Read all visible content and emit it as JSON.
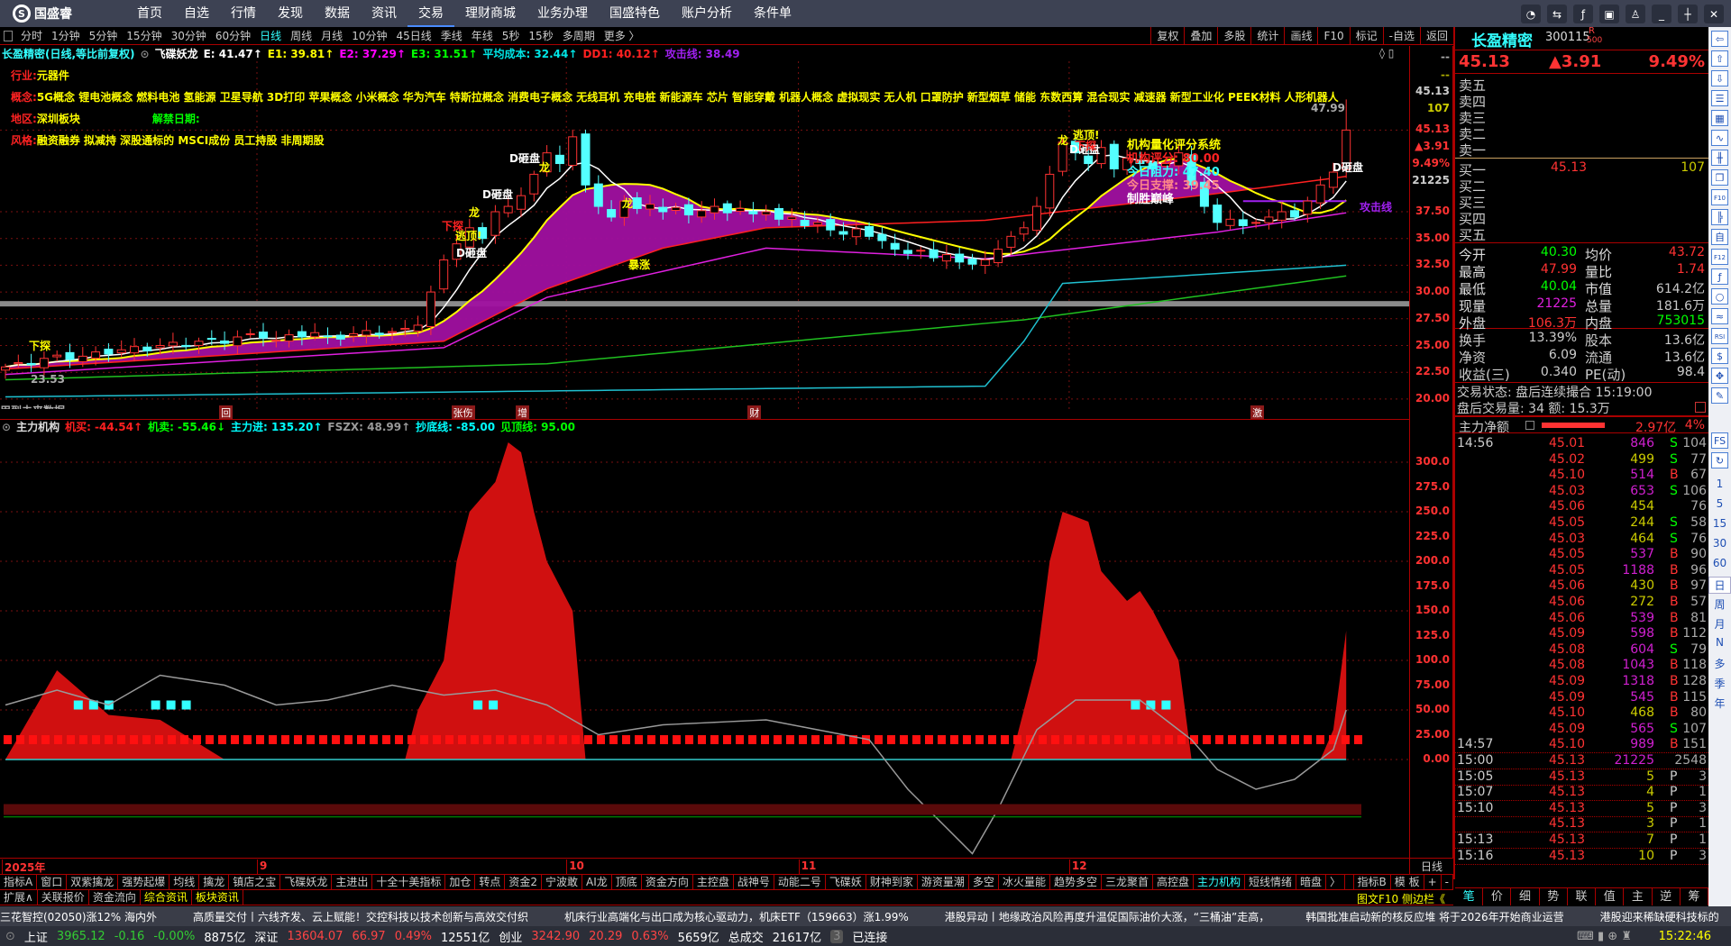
{
  "app": {
    "logo": "国盛睿",
    "menu": [
      "首页",
      "自选",
      "行情",
      "发现",
      "数据",
      "资讯",
      "交易",
      "理财商城",
      "业务办理",
      "国盛特色",
      "账户分析",
      "条件单"
    ],
    "active_menu": "交易",
    "window_controls": [
      "message-icon",
      "settings-icon",
      "formula-icon",
      "monitor-icon",
      "skin-icon",
      "minimize-icon",
      "restore-icon",
      "close-icon"
    ]
  },
  "periods": [
    "分时",
    "1分钟",
    "5分钟",
    "15分钟",
    "30分钟",
    "60分钟",
    "日线",
    "周线",
    "月线",
    "10分钟",
    "45日线",
    "季线",
    "年线",
    "5秒",
    "15秒",
    "多周期",
    "更多 〉"
  ],
  "active_period": "日线",
  "chart_tools": [
    "复权",
    "叠加",
    "多股",
    "统计",
    "画线",
    "F10",
    "标记",
    "-自选",
    "返回"
  ],
  "chart_header": {
    "title": "长盈精密(日线,等比前复权)",
    "indicator": "飞碟妖龙",
    "items": [
      {
        "label": "E: 41.47↑",
        "color": "#ffffff"
      },
      {
        "label": "E1: 39.81↑",
        "color": "#ffff00"
      },
      {
        "label": "E2: 37.29↑",
        "color": "#ff00ff"
      },
      {
        "label": "E3: 31.51↑",
        "color": "#00ff00"
      },
      {
        "label": "平均成本: 32.44↑",
        "color": "#00e5e5"
      },
      {
        "label": "DD1: 40.12↑",
        "color": "#ff2020"
      },
      {
        "label": "攻击线: 38.49",
        "color": "#a020f0"
      }
    ]
  },
  "info": {
    "industry_label": "行业:",
    "industry": "元器件",
    "concept_label": "概念:",
    "concepts": "5G概念 锂电池概念 燃料电池 氢能源 卫星导航 3D打印 苹果概念 小米概念 华为汽车 特斯拉概念 消费电子概念 无线耳机 充电桩 新能源车 芯片 智能穿戴 机器人概念 虚拟现实 无人机 口罩防护 新型烟草 储能 东数西算 混合现实 减速器 新型工业化 PEEK材料 人形机器人",
    "region_label": "地区:",
    "region": "深圳板块",
    "unlock_label": "解禁日期:",
    "style_label": "风格:",
    "styles": "融资融券 拟减持 深股通标的 MSCI成份 员工持股 非周期股"
  },
  "annotations": {
    "d1": "D砸盘",
    "d2": "D砸盘",
    "d3": "D砸盘",
    "d4": "D砸盘",
    "d5": "D砸盘",
    "dragon1": "龙",
    "dragon2": "龙",
    "dragon3": "龙",
    "dragon4": "龙",
    "escape1": "逃顶!",
    "escape2": "逃顶!",
    "probe1": "下探",
    "probe2": "下探",
    "surge": "暴涨",
    "attack": "攻击线",
    "sys_title": "机构量化评分系统",
    "score": "机构评分: 80.00",
    "resist": "今日阻力: 47.40",
    "support": "今日支撑: 39.45",
    "peak": "制胜巅峰",
    "high_mark": "47.99",
    "low_mark": "23.53",
    "future": "用到未来数据",
    "start": "下探"
  },
  "price_axis": {
    "top": [
      "--",
      "--",
      "45.13",
      "107",
      "45.13",
      "▲3.91",
      "9.49%",
      "21225"
    ],
    "ticks": [
      "37.50",
      "35.00",
      "32.50",
      "30.00",
      "27.50",
      "25.00",
      "22.50",
      "20.00"
    ]
  },
  "markers": [
    {
      "label": "回",
      "i": 17
    },
    {
      "label": "张伤",
      "i": 35
    },
    {
      "label": "增",
      "i": 40
    },
    {
      "label": "财",
      "i": 58
    },
    {
      "label": "激",
      "i": 97
    }
  ],
  "indicator_header": {
    "name": "主力机构",
    "items": [
      {
        "label": "机买: -44.54↑",
        "color": "#ff2020"
      },
      {
        "label": "机卖: -55.46↓",
        "color": "#00ff00"
      },
      {
        "label": "主力进: 135.20↑",
        "color": "#00ffff"
      },
      {
        "label": "FSZX: 48.99↑",
        "color": "#9a9a9a"
      },
      {
        "label": "抄底线: -85.00",
        "color": "#00ffff"
      },
      {
        "label": "见顶线: 95.00",
        "color": "#00ff00"
      }
    ]
  },
  "indicator_axis": [
    "300.0",
    "275.0",
    "250.0",
    "225.0",
    "200.0",
    "175.0",
    "150.0",
    "125.0",
    "100.0",
    "75.00",
    "50.00",
    "25.00",
    "0.00"
  ],
  "dates": [
    {
      "label": "2025年",
      "i": 0
    },
    {
      "label": "9",
      "i": 20
    },
    {
      "label": "10",
      "i": 44
    },
    {
      "label": "11",
      "i": 62
    },
    {
      "label": "12",
      "i": 83
    }
  ],
  "period_label": "日线",
  "tabs_row1": [
    "指标A",
    "窗口",
    "双紫擒龙",
    "强势起爆",
    "均线",
    "擒龙",
    "镇店之宝",
    "飞碟妖龙",
    "主进出",
    "十全十美指标",
    "加仓",
    "转点",
    "资金2",
    "宁波敢",
    "AI龙",
    "顶底",
    "资金方向",
    "主控盘",
    "战神号",
    "动能二号",
    "飞碟妖",
    "财神到家",
    "游资量潮",
    "多空",
    "冰火量能",
    "趋势多空",
    "三龙聚首",
    "高控盘",
    "主力机构",
    "短线情绪",
    "暗盘",
    "〉"
  ],
  "tabs_row1_right": [
    "指标B",
    "模 板",
    "+",
    "-"
  ],
  "active_tab": "主力机构",
  "tabs_row2": [
    "扩展∧",
    "关联报价",
    "资金流向",
    "综合资讯",
    "板块资讯"
  ],
  "tabs_row2_right": "图文F10 侧边栏《",
  "ticker": [
    "三花智控(02050)涨12% 海内外",
    "高质量交付丨六线齐发、云上赋能！交控科技以技术创新与高效交付织",
    "机床行业高端化与出口成为核心驱动力，机床ETF（159663）涨1.99%",
    "港股异动丨地缘政治风险再度升温促国际油价大涨，“三桶油”走高，",
    "韩国批准启动新的核反应堆 将于2026年开始商业运营",
    "港股迎来稀缺硬科技标的"
  ],
  "status": {
    "sh_label": "上证",
    "sh": "3965.12",
    "sh_chg": "-0.16",
    "sh_pct": "-0.00%",
    "sh_amt": "8875亿",
    "sz_label": "深证",
    "sz": "13604.07",
    "sz_chg": "66.97",
    "sz_pct": "0.49%",
    "sz_amt": "12551亿",
    "cy_label": "创业",
    "cy": "3242.90",
    "cy_chg": "20.29",
    "cy_pct": "0.63%",
    "cy_amt": "5659亿",
    "total_label": "总成交",
    "total": "21617亿",
    "conn_count": "3",
    "conn": "已连接",
    "time": "15:22:46"
  },
  "quote": {
    "name": "长盈精密",
    "code": "300115",
    "flag_r": "R",
    "flag_n": "500",
    "price": "45.13",
    "change": "▲3.91",
    "pct": "9.49%",
    "asks": [
      "卖五",
      "卖四",
      "卖三",
      "卖二",
      "卖一"
    ],
    "bids": [
      {
        "label": "买一",
        "price": "45.13",
        "vol": "107"
      },
      {
        "label": "买二"
      },
      {
        "label": "买三"
      },
      {
        "label": "买四"
      },
      {
        "label": "买五"
      }
    ],
    "stats": [
      [
        "今开",
        "40.30",
        "#00ff00",
        "均价",
        "43.72",
        "#ff3232"
      ],
      [
        "最高",
        "47.99",
        "#ff3232",
        "量比",
        "1.74",
        "#ff3232"
      ],
      [
        "最低",
        "40.04",
        "#00ff00",
        "市值",
        "614.2亿",
        "#c8c8c8"
      ],
      [
        "现量",
        "21225",
        "#e020e0",
        "总量",
        "181.6万",
        "#c8c8c8"
      ],
      [
        "外盘",
        "106.3万",
        "#ff3232",
        "内盘",
        "753015",
        "#00ff00"
      ]
    ],
    "stats2": [
      [
        "换手",
        "13.39%",
        "股本",
        "13.6亿"
      ],
      [
        "净资",
        "6.09",
        "流通",
        "13.6亿"
      ],
      [
        "收益(三)",
        "0.340",
        "PE(动)",
        "98.4"
      ]
    ],
    "trade_status": "交易状态: 盘后连续撮合 15:19:00",
    "after_hours": "盘后交易量: 34  额: 15.3万",
    "net_label": "主力净额",
    "net": "2.97亿",
    "net_pct": "4%",
    "net_fill": 0.74
  },
  "ticks": [
    [
      "14:56",
      "45.01",
      "846",
      "S",
      "104"
    ],
    [
      "",
      "45.02",
      "499",
      "S",
      "77"
    ],
    [
      "",
      "45.10",
      "514",
      "B",
      "67"
    ],
    [
      "",
      "45.03",
      "653",
      "S",
      "106"
    ],
    [
      "",
      "45.06",
      "454",
      "",
      "76"
    ],
    [
      "",
      "45.05",
      "244",
      "S",
      "58"
    ],
    [
      "",
      "45.03",
      "464",
      "S",
      "76"
    ],
    [
      "",
      "45.05",
      "537",
      "B",
      "90"
    ],
    [
      "",
      "45.05",
      "1188",
      "B",
      "96"
    ],
    [
      "",
      "45.06",
      "430",
      "B",
      "97"
    ],
    [
      "",
      "45.06",
      "272",
      "B",
      "57"
    ],
    [
      "",
      "45.06",
      "539",
      "B",
      "81"
    ],
    [
      "",
      "45.09",
      "598",
      "B",
      "112"
    ],
    [
      "",
      "45.08",
      "604",
      "S",
      "79"
    ],
    [
      "",
      "45.08",
      "1043",
      "B",
      "118"
    ],
    [
      "",
      "45.09",
      "1318",
      "B",
      "128"
    ],
    [
      "",
      "45.09",
      "545",
      "B",
      "115"
    ],
    [
      "",
      "45.10",
      "468",
      "B",
      "80"
    ],
    [
      "",
      "45.09",
      "565",
      "S",
      "107"
    ],
    [
      "14:57",
      "45.10",
      "989",
      "B",
      "151"
    ],
    [
      "15:00",
      "45.13",
      "21225",
      "",
      "2548"
    ],
    [
      "15:05",
      "45.13",
      "5",
      "P",
      "3"
    ],
    [
      "15:07",
      "45.13",
      "4",
      "P",
      "1"
    ],
    [
      "15:10",
      "45.13",
      "5",
      "P",
      "3"
    ],
    [
      "",
      "45.13",
      "3",
      "P",
      "1"
    ],
    [
      "15:13",
      "45.13",
      "7",
      "P",
      "1"
    ],
    [
      "15:16",
      "45.13",
      "10",
      "P",
      "3"
    ]
  ],
  "right_tabs": [
    "笔",
    "价",
    "细",
    "势",
    "联",
    "值",
    "主",
    "逆",
    "筹"
  ],
  "sidebar": {
    "icons": [
      "back-arrow-icon",
      "up-arrow-icon",
      "down-arrow-icon",
      "quote-list-icon",
      "grid-icon",
      "trend-icon",
      "kline-icon",
      "window-icon",
      "f10-icon",
      "tree-icon",
      "self-select-icon",
      "f12-icon",
      "formula-icon",
      "circle-icon",
      "wave-icon",
      "rsi-icon",
      "money-icon",
      "move-icon",
      "pencil-icon",
      "fs-icon",
      "refresh-icon"
    ],
    "periods": [
      "1",
      "5",
      "15",
      "30",
      "60",
      "日",
      "周",
      "月",
      "N",
      "多",
      "季",
      "年"
    ]
  },
  "chart_data": {
    "type": "candlestick",
    "ylim": [
      20,
      37.5
    ],
    "closes": [
      23.0,
      23.4,
      23.2,
      23.8,
      24.1,
      23.7,
      24.0,
      24.4,
      24.2,
      24.6,
      24.9,
      24.5,
      25.0,
      25.3,
      24.9,
      25.4,
      25.6,
      25.2,
      25.8,
      26.1,
      25.7,
      25.5,
      26.0,
      25.8,
      26.2,
      25.9,
      25.6,
      26.1,
      26.4,
      26.0,
      26.3,
      26.6,
      26.9,
      30.0,
      33.0,
      34.5,
      36.0,
      35.0,
      37.5,
      38.0,
      39.0,
      41.0,
      43.0,
      42.0,
      44.5,
      40.0,
      38.0,
      37.0,
      38.5,
      37.8,
      38.2,
      37.5,
      37.9,
      37.2,
      37.6,
      38.0,
      37.4,
      37.8,
      37.3,
      37.5,
      36.8,
      37.0,
      36.2,
      36.5,
      35.8,
      35.4,
      35.9,
      35.2,
      34.8,
      34.0,
      33.6,
      33.9,
      33.2,
      33.5,
      32.8,
      32.6,
      33.0,
      34.0,
      35.2,
      36.0,
      38.0,
      41.0,
      44.0,
      43.0,
      42.0,
      43.5,
      41.5,
      42.5,
      42.0,
      41.5,
      42.0,
      43.0,
      40.0,
      38.0,
      36.5,
      36.8,
      36.2,
      36.5,
      37.0,
      37.5,
      37.0,
      38.5,
      40.0,
      41.2,
      45.13
    ],
    "last_high": 47.99,
    "ma_lines": [
      {
        "name": "red",
        "color": "#ff2020",
        "points": [
          [
            0,
            22.8
          ],
          [
            34,
            25.4
          ],
          [
            42,
            30.3
          ],
          [
            51,
            34.1
          ],
          [
            59,
            36
          ],
          [
            76,
            36.7
          ],
          [
            94,
            39.2
          ],
          [
            104,
            40.8
          ]
        ]
      },
      {
        "name": "magenta",
        "color": "#e020e0",
        "points": [
          [
            0,
            22.3
          ],
          [
            34,
            24.8
          ],
          [
            42,
            29.5
          ],
          [
            59,
            34.1
          ],
          [
            76,
            33.1
          ],
          [
            94,
            35.6
          ],
          [
            104,
            37.4
          ]
        ]
      },
      {
        "name": "green",
        "color": "#20c020",
        "points": [
          [
            0,
            21.8
          ],
          [
            42,
            23.3
          ],
          [
            79,
            27.4
          ],
          [
            104,
            31.5
          ]
        ]
      },
      {
        "name": "cyan",
        "color": "#20c0d0",
        "points": [
          [
            0,
            20.2
          ],
          [
            76,
            21.2
          ],
          [
            79,
            25.4
          ],
          [
            82,
            30.8
          ],
          [
            104,
            32.5
          ]
        ]
      }
    ],
    "indicator": {
      "area": [
        [
          0,
          0
        ],
        [
          4,
          90
        ],
        [
          8,
          45
        ],
        [
          12,
          40
        ],
        [
          17,
          0
        ],
        [
          31,
          0
        ],
        [
          32,
          50
        ],
        [
          34,
          100
        ],
        [
          35,
          200
        ],
        [
          36,
          250
        ],
        [
          38,
          280
        ],
        [
          39,
          320
        ],
        [
          40,
          310
        ],
        [
          41,
          250
        ],
        [
          42,
          200
        ],
        [
          44,
          150
        ],
        [
          45,
          0
        ],
        [
          78,
          0
        ],
        [
          80,
          100
        ],
        [
          81,
          200
        ],
        [
          82,
          250
        ],
        [
          84,
          240
        ],
        [
          85,
          190
        ],
        [
          87,
          160
        ],
        [
          88,
          170
        ],
        [
          89,
          150
        ],
        [
          91,
          100
        ],
        [
          92,
          0
        ],
        [
          102,
          0
        ],
        [
          103,
          30
        ],
        [
          104,
          130
        ]
      ],
      "line": [
        [
          0,
          55
        ],
        [
          4,
          70
        ],
        [
          8,
          55
        ],
        [
          12,
          85
        ],
        [
          17,
          75
        ],
        [
          21,
          55
        ],
        [
          25,
          60
        ],
        [
          30,
          75
        ],
        [
          34,
          65
        ],
        [
          38,
          70
        ],
        [
          42,
          55
        ],
        [
          46,
          25
        ],
        [
          51,
          35
        ],
        [
          59,
          40
        ],
        [
          67,
          20
        ],
        [
          70,
          -30
        ],
        [
          75,
          -95
        ],
        [
          77,
          -50
        ],
        [
          80,
          30
        ],
        [
          83,
          60
        ],
        [
          88,
          60
        ],
        [
          92,
          20
        ],
        [
          94,
          -10
        ],
        [
          97,
          -30
        ],
        [
          100,
          -20
        ],
        [
          103,
          10
        ],
        [
          104,
          50
        ]
      ],
      "signal_level": 20,
      "squares": [
        6,
        12,
        37,
        88
      ]
    }
  }
}
